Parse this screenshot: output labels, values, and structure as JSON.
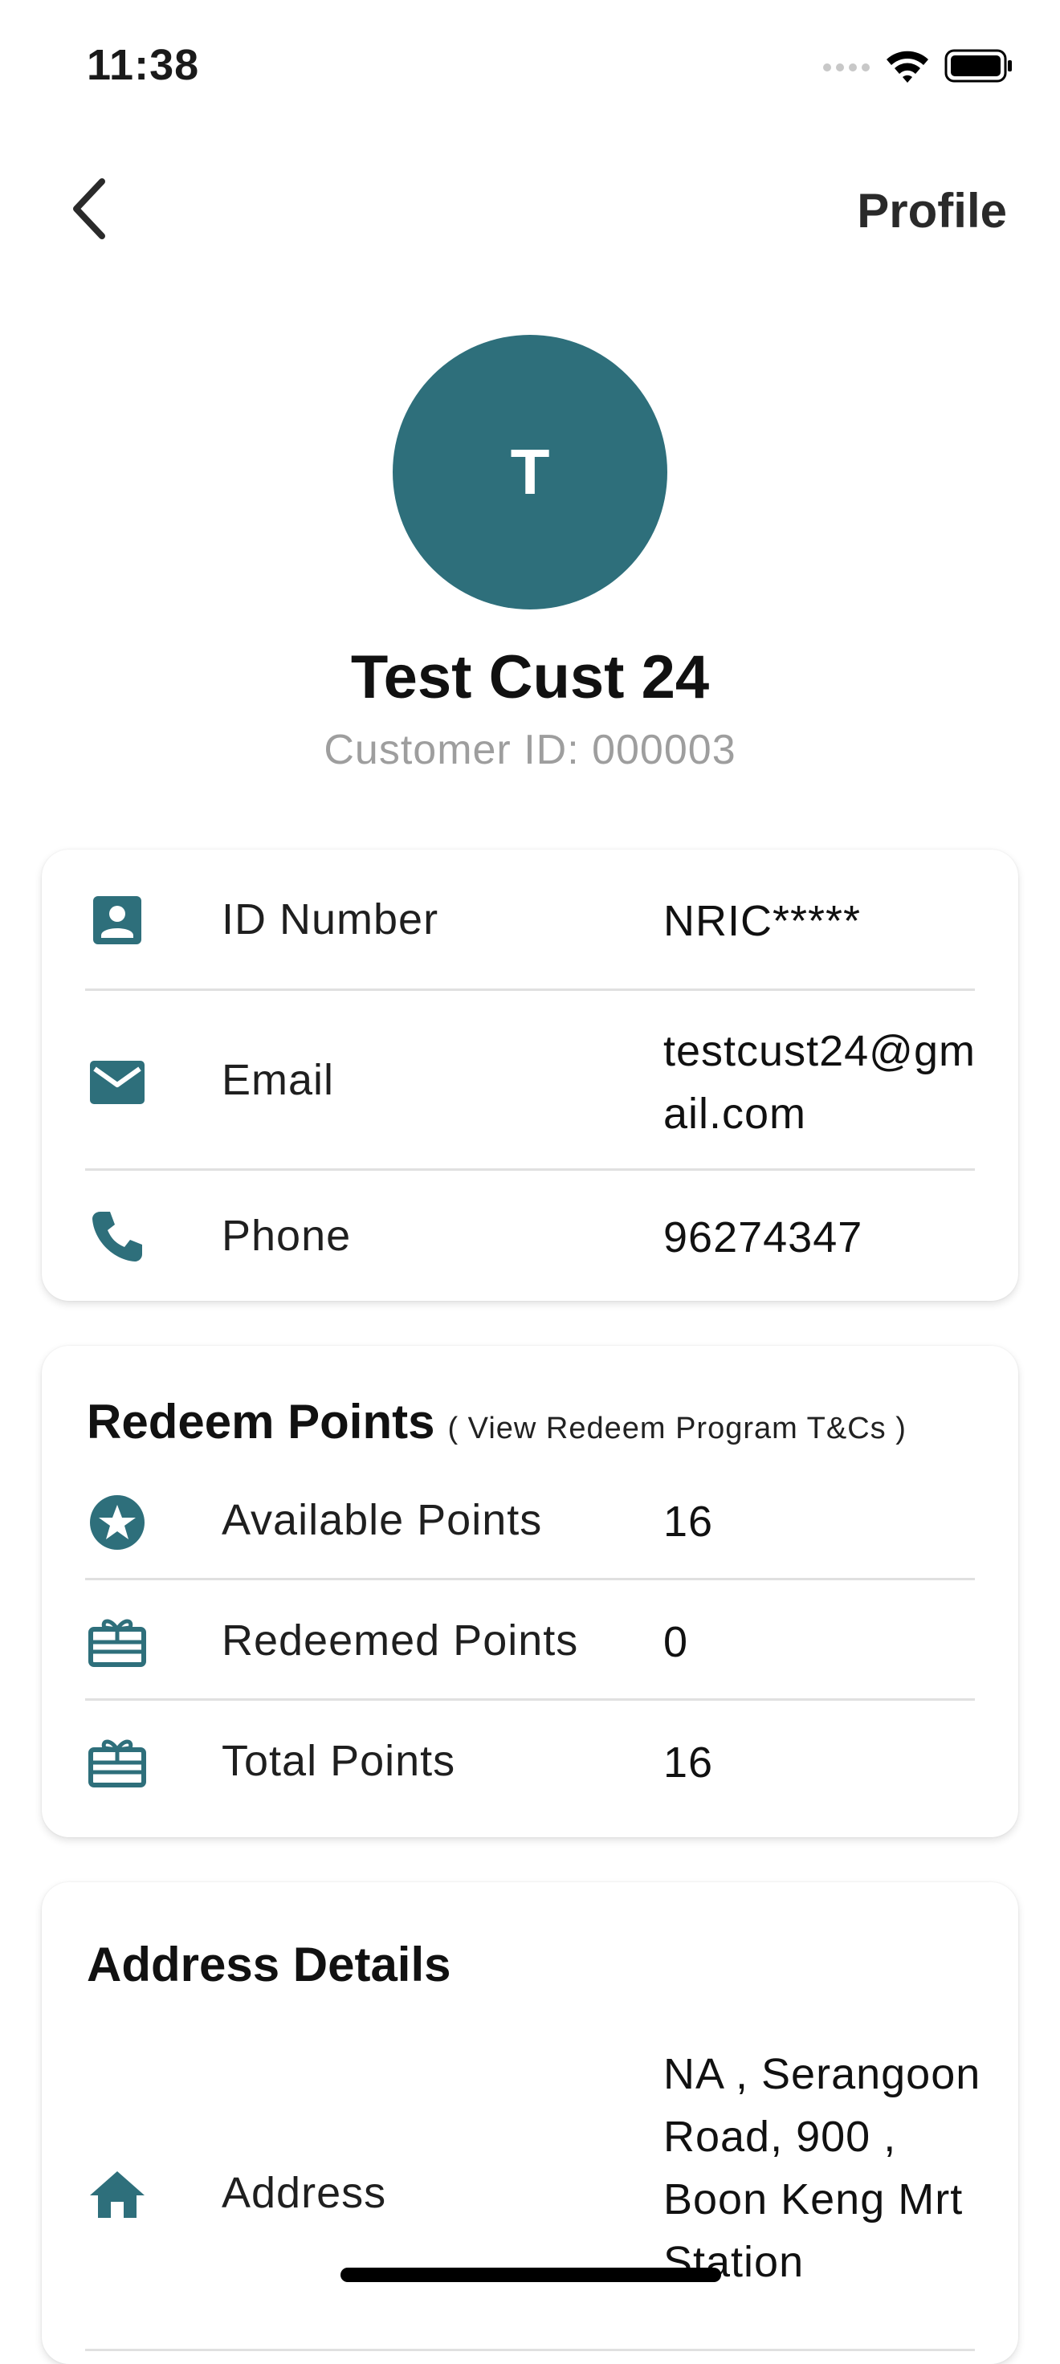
{
  "status_bar": {
    "time": "11:38"
  },
  "nav": {
    "title": "Profile"
  },
  "profile": {
    "initial": "T",
    "name": "Test Cust 24",
    "customer_id": "Customer ID: 000003"
  },
  "info": [
    {
      "icon": "id-card-icon",
      "label": "ID Number",
      "value": "NRIC*****"
    },
    {
      "icon": "email-icon",
      "label": "Email",
      "value": "testcust24@gmail.com"
    },
    {
      "icon": "phone-icon",
      "label": "Phone",
      "value": "96274347"
    }
  ],
  "points": {
    "title": "Redeem Points",
    "tc_link": "( View Redeem Program T&Cs )",
    "rows": [
      {
        "icon": "star-badge-icon",
        "label": "Available Points",
        "value": "16"
      },
      {
        "icon": "gift-card-icon",
        "label": "Redeemed Points",
        "value": "0"
      },
      {
        "icon": "gift-card-icon",
        "label": "Total Points",
        "value": "16"
      }
    ]
  },
  "address": {
    "title": "Address Details",
    "rows": [
      {
        "icon": "home-icon",
        "label": "Address",
        "value": "NA ,  Serangoon Road, 900 , Boon Keng Mrt Station"
      }
    ]
  },
  "colors": {
    "accent": "#2e6f7b",
    "muted_text": "#9e9e9e",
    "divider": "#e0e0e0"
  }
}
